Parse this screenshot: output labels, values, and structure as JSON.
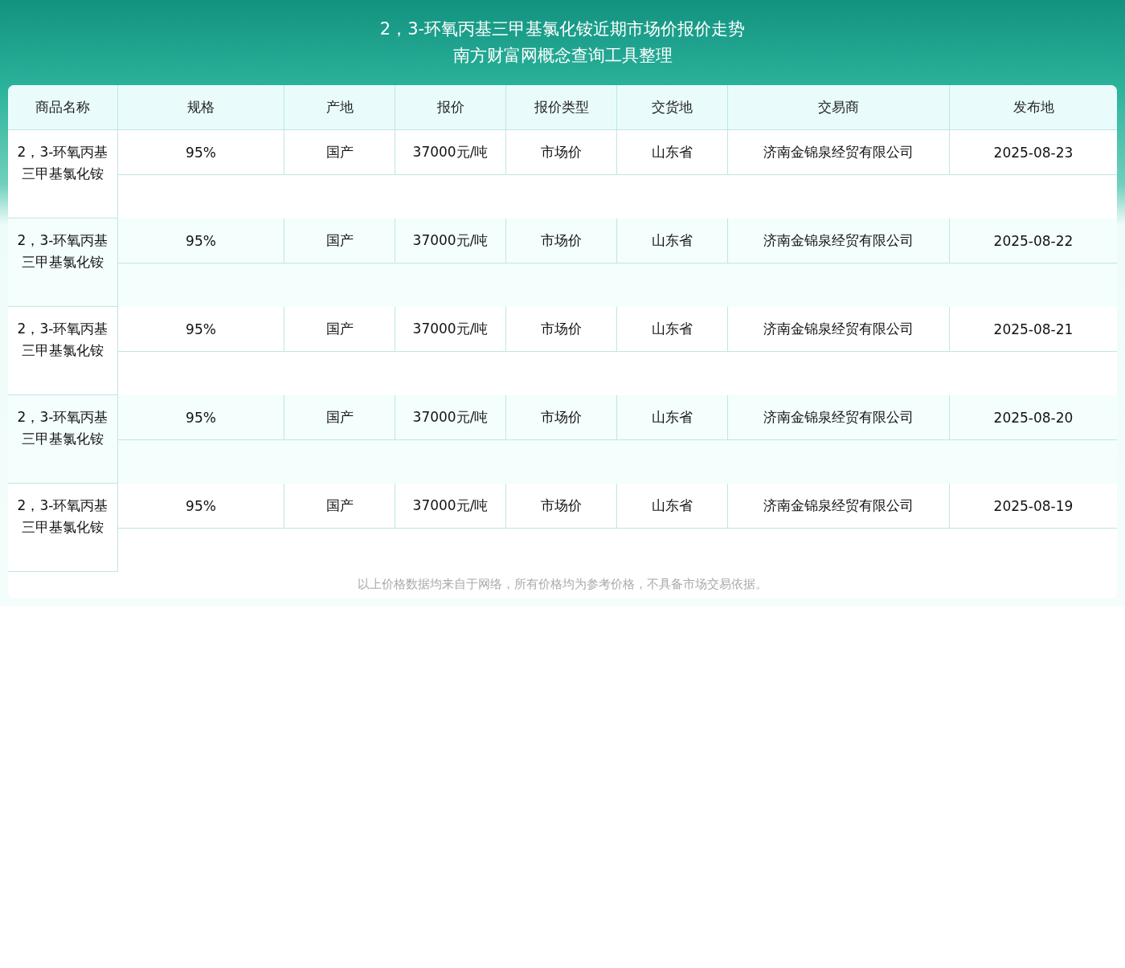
{
  "header": {
    "title": "2，3-环氧丙基三甲基氯化铵近期市场价报价走势",
    "subtitle": "南方财富网概念查询工具整理"
  },
  "table": {
    "columns": [
      "商品名称",
      "规格",
      "产地",
      "报价",
      "报价类型",
      "交货地",
      "交易商",
      "发布地"
    ],
    "rows": [
      {
        "cells": [
          "2，3-环氧丙基三甲基氯化铵",
          "95%",
          "国产",
          "37000元/吨",
          "市场价",
          "山东省",
          "济南金锦泉经贸有限公司",
          "2025-08-23"
        ]
      },
      {
        "cells": [
          "2，3-环氧丙基三甲基氯化铵",
          "95%",
          "国产",
          "37000元/吨",
          "市场价",
          "山东省",
          "济南金锦泉经贸有限公司",
          "2025-08-22"
        ]
      },
      {
        "cells": [
          "2，3-环氧丙基三甲基氯化铵",
          "95%",
          "国产",
          "37000元/吨",
          "市场价",
          "山东省",
          "济南金锦泉经贸有限公司",
          "2025-08-21"
        ]
      },
      {
        "cells": [
          "2，3-环氧丙基三甲基氯化铵",
          "95%",
          "国产",
          "37000元/吨",
          "市场价",
          "山东省",
          "济南金锦泉经贸有限公司",
          "2025-08-20"
        ]
      },
      {
        "cells": [
          "2，3-环氧丙基三甲基氯化铵",
          "95%",
          "国产",
          "37000元/吨",
          "市场价",
          "山东省",
          "济南金锦泉经贸有限公司",
          "2025-08-19"
        ]
      }
    ]
  },
  "footnote": "以上价格数据均来自于网络，所有价格均为参考价格，不具备市场交易依据。"
}
